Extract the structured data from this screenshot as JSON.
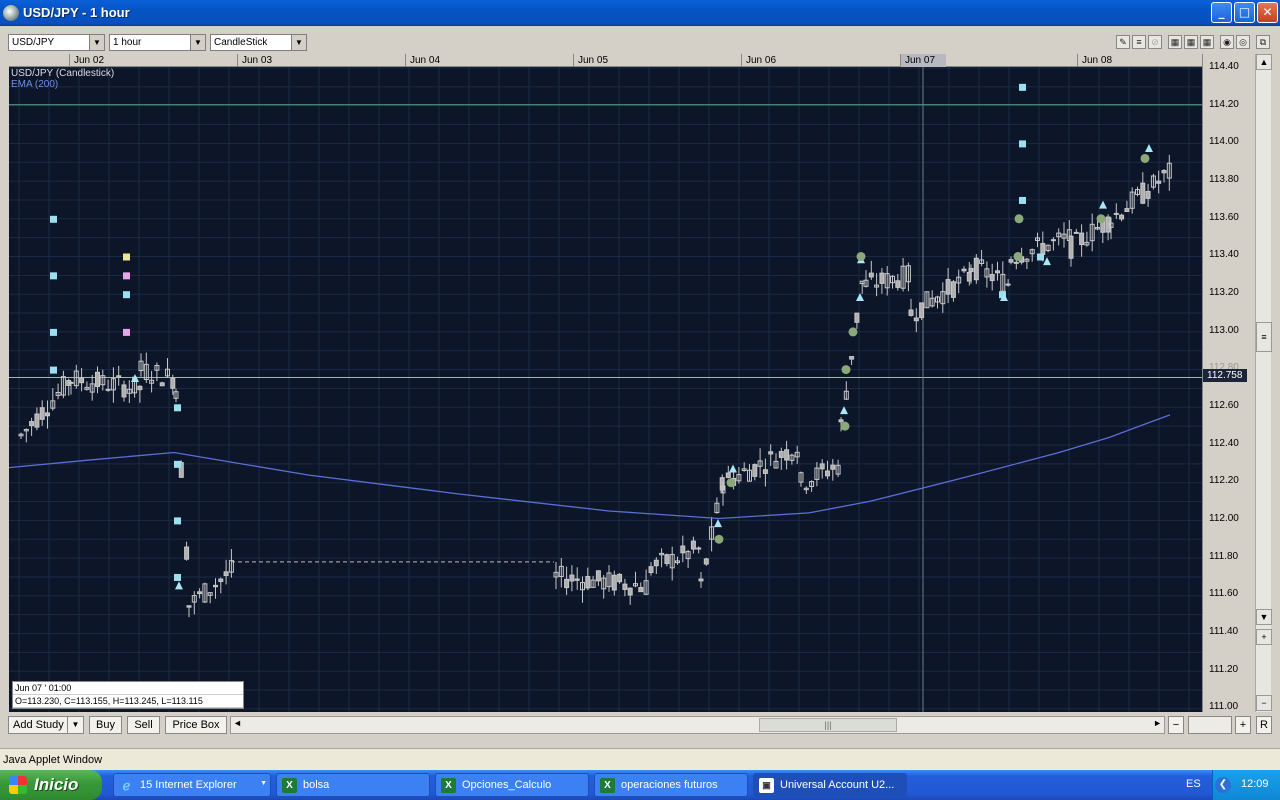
{
  "window": {
    "title": "USD/JPY - 1 hour",
    "buttons": {
      "minimize": "_",
      "maximize": "□",
      "close": "✕"
    }
  },
  "toolbar": {
    "symbol": "USD/JPY",
    "interval": "1 hour",
    "chart_type": "CandleStick",
    "dropdown_arrow": "▼",
    "icons": [
      "pencil-icon",
      "lines-icon",
      "eraser-icon",
      "grid-icon",
      "grid2-icon",
      "grid3-icon",
      "zoom-icon",
      "settings-icon",
      "detach-icon"
    ]
  },
  "chart": {
    "legend_title": "USD/JPY (Candlestick)",
    "legend_ema": "EMA (200)",
    "date_labels": [
      "Jun 02",
      "Jun 03",
      "Jun 04",
      "Jun 05",
      "Jun 06",
      "Jun 07",
      "Jun 08"
    ],
    "price_labels": [
      "114.40",
      "114.20",
      "114.00",
      "113.80",
      "113.60",
      "113.40",
      "113.20",
      "113.00",
      "112.80",
      "112.60",
      "112.40",
      "112.20",
      "112.00",
      "111.80",
      "111.60",
      "111.40",
      "111.20",
      "111.00"
    ],
    "current_price": "112.758",
    "info": {
      "date": "Jun 07 ' 01:00",
      "ohlc": "O=113.230, C=113.155, H=113.245, L=113.115"
    },
    "colors": {
      "background": "#0d1528",
      "ema": "#5a6fd8",
      "candle": "#c8c8c8",
      "grid": "#1b2a44"
    }
  },
  "bottombar": {
    "add_study": "Add Study",
    "buy": "Buy",
    "sell": "Sell",
    "price_box": "Price Box",
    "scroll_left": "◄",
    "scroll_right": "►",
    "thumb": "|||",
    "minus": "−",
    "plus": "+",
    "reset": "R"
  },
  "status": {
    "text": "Java Applet Window"
  },
  "taskbar": {
    "start": "Inicio",
    "tasks": [
      "15 Internet Explorer",
      "bolsa",
      "Opciones_Calculo",
      "operaciones futuros",
      "Universal Account U2..."
    ],
    "language": "ES",
    "clock": "12:09"
  }
}
